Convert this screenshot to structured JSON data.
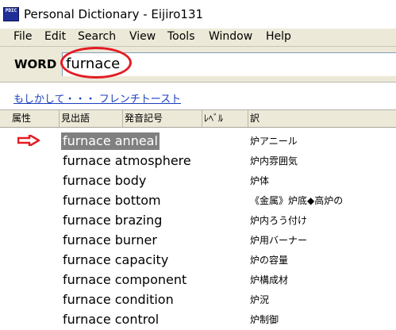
{
  "window": {
    "title": "Personal Dictionary - Eijiro131",
    "icon": "PDIC"
  },
  "menu": [
    "File",
    "Edit",
    "Search",
    "View",
    "Tools",
    "Window",
    "Help"
  ],
  "search": {
    "label": "WORD",
    "value": "furnace"
  },
  "suggestion": {
    "text": "もしかして・・・ フレンチトースト"
  },
  "columns": [
    "属性",
    "見出語",
    "発音記号",
    "ﾚﾍﾞﾙ",
    "訳"
  ],
  "entries": [
    {
      "word": "furnace anneal",
      "translation": "炉アニール"
    },
    {
      "word": "furnace atmosphere",
      "translation": "炉内雰囲気"
    },
    {
      "word": "furnace body",
      "translation": "炉体"
    },
    {
      "word": "furnace bottom",
      "translation": "《金属》炉底◆高炉の"
    },
    {
      "word": "furnace brazing",
      "translation": "炉内ろう付け"
    },
    {
      "word": "furnace burner",
      "translation": "炉用バーナー"
    },
    {
      "word": "furnace capacity",
      "translation": "炉の容量"
    },
    {
      "word": "furnace component",
      "translation": "炉構成材"
    },
    {
      "word": "furnace condition",
      "translation": "炉況"
    },
    {
      "word": "furnace control",
      "translation": "炉制御"
    }
  ],
  "annotation_color": "#e41b23",
  "selection_color": "#808080"
}
